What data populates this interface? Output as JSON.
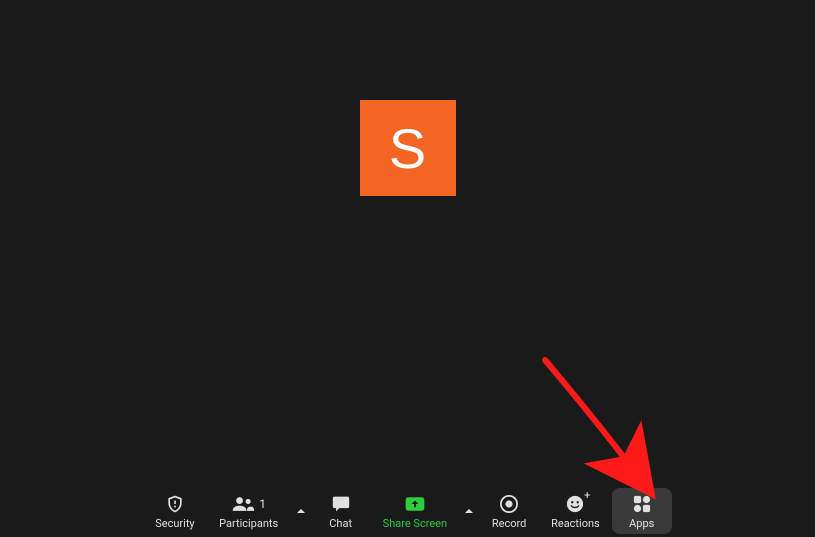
{
  "avatar": {
    "letter": "S",
    "bg_color": "#f26522"
  },
  "toolbar": {
    "security_label": "Security",
    "participants_label": "Participants",
    "participants_count": "1",
    "chat_label": "Chat",
    "share_screen_label": "Share Screen",
    "record_label": "Record",
    "reactions_label": "Reactions",
    "apps_label": "Apps"
  },
  "colors": {
    "accent_green": "#2ecc40",
    "arrow_red": "#ff1a1a",
    "dark_bg": "#1a1a1a"
  }
}
